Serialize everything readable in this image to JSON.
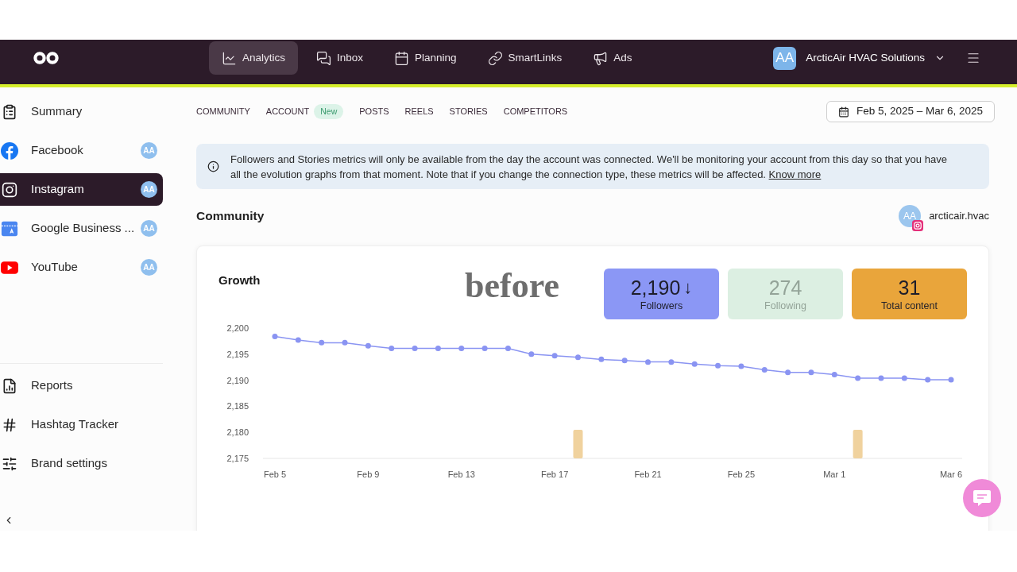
{
  "header": {
    "nav": [
      {
        "label": "Analytics",
        "selected": true
      },
      {
        "label": "Inbox",
        "selected": false
      },
      {
        "label": "Planning",
        "selected": false
      },
      {
        "label": "SmartLinks",
        "selected": false
      },
      {
        "label": "Ads",
        "selected": false
      }
    ],
    "account": {
      "initials": "AA",
      "name": "ArcticAir HVAC Solutions"
    }
  },
  "sidebar": {
    "channels": [
      {
        "label": "Summary",
        "selected": false
      },
      {
        "label": "Facebook",
        "badge": "AA",
        "selected": false
      },
      {
        "label": "Instagram",
        "badge": "AA",
        "selected": true
      },
      {
        "label": "Google Business ...",
        "badge": "AA",
        "selected": false
      },
      {
        "label": "YouTube",
        "badge": "AA",
        "selected": false
      }
    ],
    "tools": [
      {
        "label": "Reports",
        "selected": false
      },
      {
        "label": "Hashtag Tracker",
        "selected": false
      },
      {
        "label": "Brand settings",
        "selected": false
      }
    ]
  },
  "tabs": [
    {
      "label": "COMMUNITY"
    },
    {
      "label": "ACCOUNT",
      "badge": "New"
    },
    {
      "label": "POSTS"
    },
    {
      "label": "REELS"
    },
    {
      "label": "STORIES"
    },
    {
      "label": "COMPETITORS"
    }
  ],
  "date_range": "Feb 5, 2025 – Mar 6, 2025",
  "notice": {
    "text": "Followers and Stories metrics will only be available from the day the account was connected. We'll be monitoring your account from this day so that you have all the evolution graphs from that moment. Note that if you change the connection type, these metrics will be affected.",
    "link": "Know more"
  },
  "community": {
    "title": "Community",
    "account": {
      "initials": "AA",
      "handle": "arcticair.hvac"
    }
  },
  "growth": {
    "title": "Growth",
    "annotation": "before",
    "stats": [
      {
        "value": "2,190",
        "trend": "↓",
        "label": "Followers",
        "active": true,
        "color": "#8b97f5"
      },
      {
        "value": "274",
        "label": "Following",
        "active": false,
        "color": "#dcefe2"
      },
      {
        "value": "31",
        "label": "Total content",
        "active": true,
        "color": "#e9a53b"
      }
    ],
    "chart_data": {
      "type": "line",
      "categories": [
        "Feb 5",
        null,
        null,
        null,
        "Feb 9",
        null,
        null,
        null,
        "Feb 13",
        null,
        null,
        null,
        "Feb 17",
        null,
        null,
        null,
        "Feb 21",
        null,
        null,
        null,
        "Feb 25",
        null,
        null,
        null,
        "Mar 1",
        null,
        null,
        null,
        null,
        "Mar 6"
      ],
      "ylim": [
        2175,
        2200
      ],
      "yticks": [
        {
          "value": 2175,
          "label": "2,175"
        },
        {
          "value": 2180,
          "label": "2,180"
        },
        {
          "value": 2185,
          "label": "2,185"
        },
        {
          "value": 2190,
          "label": "2,190"
        },
        {
          "value": 2195,
          "label": "2,195"
        },
        {
          "value": 2200,
          "label": "2,200"
        }
      ],
      "series": [
        {
          "color": "#8a94f2",
          "marker": "circle",
          "values": [
            2198.4,
            2197.7,
            2197.2,
            2197.2,
            2196.6,
            2196.1,
            2196.1,
            2196.1,
            2196.1,
            2196.1,
            2196.1,
            2195.0,
            2194.7,
            2194.4,
            2194.0,
            2193.8,
            2193.5,
            2193.5,
            2193.1,
            2192.8,
            2192.7,
            2192.0,
            2191.5,
            2191.5,
            2191.1,
            2190.4,
            2190.4,
            2190.4,
            2190.1,
            2190.1
          ]
        }
      ]
    }
  }
}
